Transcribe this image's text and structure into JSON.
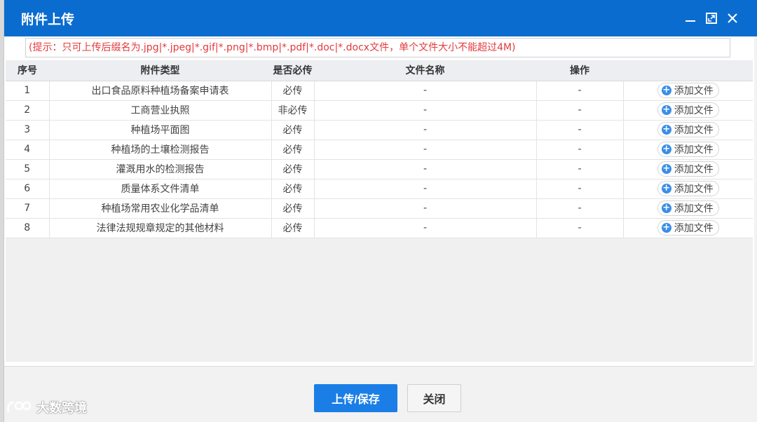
{
  "dialog": {
    "title": "附件上传",
    "hint": "(提示：只可上传后缀名为.jpg|*.jpeg|*.gif|*.png|*.bmp|*.pdf|*.doc|*.docx文件，单个文件大小不能超过4M)"
  },
  "table": {
    "headers": [
      "序号",
      "附件类型",
      "是否必传",
      "文件名称",
      "操作",
      ""
    ],
    "rows": [
      {
        "no": "1",
        "type": "出口食品原料种植场备案申请表",
        "required": "必传",
        "filename": "-",
        "op": "-",
        "action": "添加文件"
      },
      {
        "no": "2",
        "type": "工商营业执照",
        "required": "非必传",
        "filename": "-",
        "op": "-",
        "action": "添加文件"
      },
      {
        "no": "3",
        "type": "种植场平面图",
        "required": "必传",
        "filename": "-",
        "op": "-",
        "action": "添加文件"
      },
      {
        "no": "4",
        "type": "种植场的土壤检测报告",
        "required": "必传",
        "filename": "-",
        "op": "-",
        "action": "添加文件"
      },
      {
        "no": "5",
        "type": "灌溉用水的检测报告",
        "required": "必传",
        "filename": "-",
        "op": "-",
        "action": "添加文件"
      },
      {
        "no": "6",
        "type": "质量体系文件清单",
        "required": "必传",
        "filename": "-",
        "op": "-",
        "action": "添加文件"
      },
      {
        "no": "7",
        "type": "种植场常用农业化学品清单",
        "required": "必传",
        "filename": "-",
        "op": "-",
        "action": "添加文件"
      },
      {
        "no": "8",
        "type": "法律法规规章规定的其他材料",
        "required": "必传",
        "filename": "-",
        "op": "-",
        "action": "添加文件"
      }
    ]
  },
  "footer": {
    "save_label": "上传/保存",
    "close_label": "关闭"
  },
  "watermark": {
    "text": "大数跨境"
  },
  "colors": {
    "titlebar": "#0b6ccf",
    "hint": "#e4393c",
    "primary_button": "#1a7ee6"
  },
  "icons": {
    "minimize": "minimize-icon",
    "maximize": "maximize-icon",
    "close": "close-icon",
    "add": "plus-circle-icon"
  }
}
